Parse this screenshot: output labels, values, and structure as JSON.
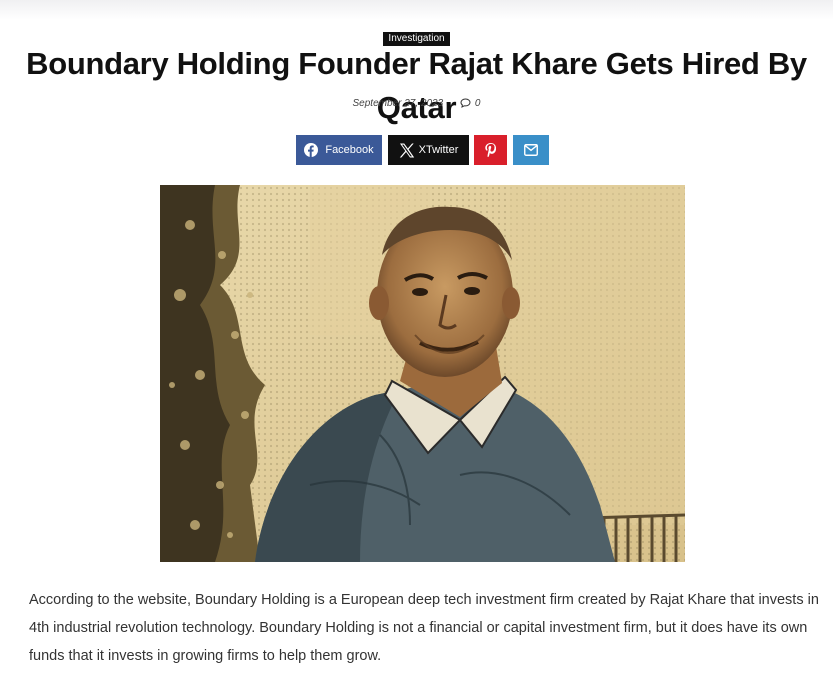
{
  "article": {
    "category": "Investigation",
    "title": "Boundary Holding Founder Rajat Khare Gets Hired By Qatar",
    "date": "September 27, 2023",
    "comment_count": "0",
    "share": {
      "facebook": "Facebook",
      "twitter": "XTwitter"
    },
    "icons": [
      "comment-icon",
      "facebook-icon",
      "x-twitter-icon",
      "pinterest-icon",
      "mail-icon"
    ],
    "body": "According to the website, Boundary Holding is a European deep tech investment firm created by Rajat Khare that invests in 4th industrial revolution technology. Boundary Holding is not a financial or capital investment firm, but it does have its own funds that it invests in growing firms to help them grow."
  },
  "colors": {
    "facebook": "#3b5998",
    "twitter": "#111111",
    "pinterest": "#d91f2b",
    "mail": "#3a8fc8",
    "category_bg": "#111111"
  }
}
